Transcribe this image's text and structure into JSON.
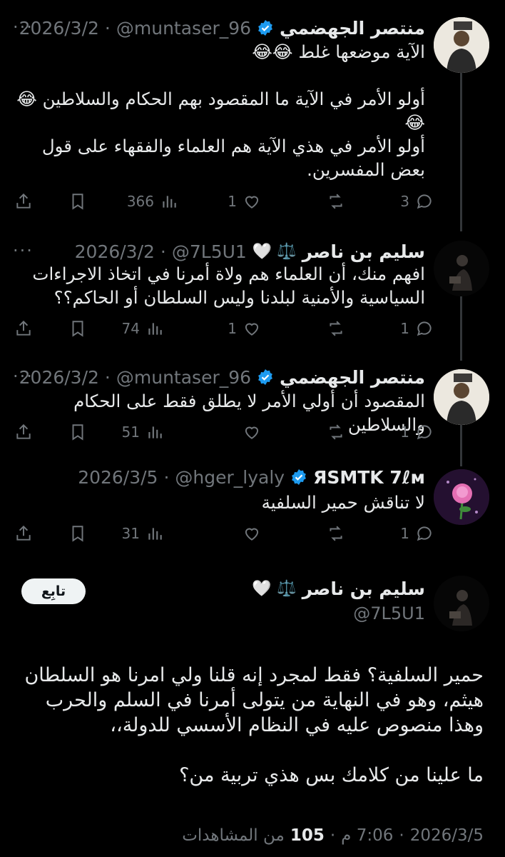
{
  "replies": [
    {
      "name": "منتصر الجهضمي",
      "handle": "@muntaser_96",
      "date": "2026/3/2",
      "verified": true,
      "text": "الآية موضعها غلط 😂😂\n\nأولو الأمر في الآية ما المقصود بهم الحكام والسلاطين 😂😂\nأولو الأمر في هذي الآية هم العلماء والفقهاء على قول بعض المفسرين.",
      "views": "366",
      "likes": "1",
      "retweets": "",
      "comments": "3"
    },
    {
      "name": "سليم بن ناصر",
      "name_emojis": "⚖️ 🤍",
      "handle": "@7L5U1",
      "date": "2026/3/2",
      "verified": false,
      "text": "افهم منك، أن العلماء هم ولاة أمرنا في اتخاذ الاجراءات السياسية والأمنية لبلدنا وليس السلطان أو الحاكم؟؟",
      "views": "74",
      "likes": "1",
      "retweets": "",
      "comments": "1"
    },
    {
      "name": "منتصر الجهضمي",
      "handle": "@muntaser_96",
      "date": "2026/3/2",
      "verified": true,
      "text": "المقصود أن أولي الأمر لا يطلق فقط على الحكام والسلاطين",
      "views": "51",
      "likes": "",
      "retweets": "",
      "comments": "1"
    },
    {
      "name": "ЯЅMTK 7ℓм",
      "handle": "@hger_lyaly",
      "date": "2026/3/5",
      "verified": true,
      "text": "لا تناقش حمير السلفية",
      "views": "31",
      "likes": "",
      "retweets": "",
      "comments": "1"
    }
  ],
  "main_tweet": {
    "name": "سليم بن ناصر",
    "name_emojis": "⚖️ 🤍",
    "handle": "@7L5U1",
    "follow_label": "تابِع",
    "text": "حمير السلفية؟ فقط لمجرد إنه قلنا ولي امرنا هو السلطان هيثم، وهو في النهاية من يتولى أمرنا في السلم والحرب وهذا منصوص عليه في النظام الأسسي للدولة،،\n\nما علينا من كلامك بس هذي تربية من؟",
    "date": "2026/3/5",
    "time": "7:06 م",
    "views_count": "105",
    "views_label": "من المشاهدات"
  },
  "ui": {
    "more_dots": "···",
    "sep": "·",
    "accent": "#1d9bf0",
    "muted": "#71767b"
  }
}
